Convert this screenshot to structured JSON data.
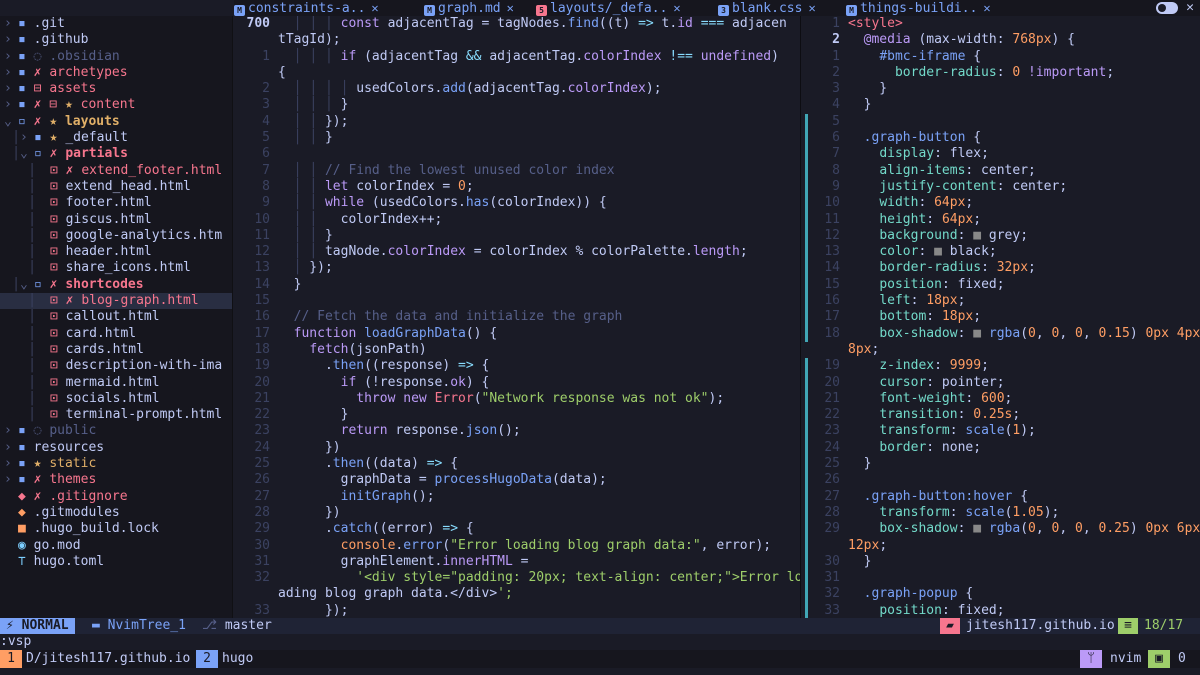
{
  "tabs": [
    {
      "label": "constraints-a..",
      "icon": "markdown-icon",
      "color": "#7aa2f7"
    },
    {
      "label": "graph.md",
      "icon": "markdown-icon",
      "color": "#7aa2f7"
    },
    {
      "label": "layouts/_defa..",
      "icon": "html-icon",
      "color": "#f7768e"
    },
    {
      "label": "blank.css",
      "icon": "css-icon",
      "color": "#7aa2f7"
    },
    {
      "label": "things-buildi..",
      "icon": "markdown-icon",
      "color": "#7aa2f7"
    }
  ],
  "tab_close": "✕",
  "tree": [
    {
      "arrow": "›",
      "icon": "▪",
      "mark": "",
      "name": ".git",
      "cls": "c-file",
      "indent": 0
    },
    {
      "arrow": "›",
      "icon": "▪",
      "mark": "",
      "name": ".github",
      "cls": "c-file",
      "indent": 0
    },
    {
      "arrow": "›",
      "icon": "▪",
      "mark": "◌",
      "name": ".obsidian",
      "cls": "c-dim",
      "indent": 0
    },
    {
      "arrow": "›",
      "icon": "▪",
      "mark": "✗",
      "name": "archetypes",
      "cls": "c-red",
      "indent": 0
    },
    {
      "arrow": "›",
      "icon": "▪",
      "mark": "⊟",
      "name": "assets",
      "cls": "c-red",
      "indent": 0
    },
    {
      "arrow": "›",
      "icon": "▪",
      "mark": "✗ ⊟ ★",
      "name": "content",
      "cls": "c-red",
      "indent": 0
    },
    {
      "arrow": "⌄",
      "icon": "▫",
      "mark": "✗ ★",
      "name": "layouts",
      "cls": "c-yel c-bold",
      "indent": 0
    },
    {
      "arrow": "›",
      "icon": "▪",
      "mark": "★",
      "name": "_default",
      "cls": "c-file",
      "indent": 1
    },
    {
      "arrow": "⌄",
      "icon": "▫",
      "mark": "✗",
      "name": "partials",
      "cls": "c-red c-bold",
      "indent": 1
    },
    {
      "arrow": "",
      "icon": "⊡",
      "mark": "✗",
      "name": "extend_footer.html",
      "cls": "c-red",
      "indent": 2
    },
    {
      "arrow": "",
      "icon": "⊡",
      "mark": "",
      "name": "extend_head.html",
      "cls": "c-file",
      "indent": 2
    },
    {
      "arrow": "",
      "icon": "⊡",
      "mark": "",
      "name": "footer.html",
      "cls": "c-file",
      "indent": 2
    },
    {
      "arrow": "",
      "icon": "⊡",
      "mark": "",
      "name": "giscus.html",
      "cls": "c-file",
      "indent": 2
    },
    {
      "arrow": "",
      "icon": "⊡",
      "mark": "",
      "name": "google-analytics.htm",
      "cls": "c-file",
      "indent": 2
    },
    {
      "arrow": "",
      "icon": "⊡",
      "mark": "",
      "name": "header.html",
      "cls": "c-file",
      "indent": 2
    },
    {
      "arrow": "",
      "icon": "⊡",
      "mark": "",
      "name": "share_icons.html",
      "cls": "c-file",
      "indent": 2
    },
    {
      "arrow": "⌄",
      "icon": "▫",
      "mark": "✗",
      "name": "shortcodes",
      "cls": "c-red c-bold",
      "indent": 1
    },
    {
      "arrow": "",
      "icon": "⊡",
      "mark": "✗",
      "name": "blog-graph.html",
      "cls": "c-red",
      "indent": 2,
      "selected": true
    },
    {
      "arrow": "",
      "icon": "⊡",
      "mark": "",
      "name": "callout.html",
      "cls": "c-file",
      "indent": 2
    },
    {
      "arrow": "",
      "icon": "⊡",
      "mark": "",
      "name": "card.html",
      "cls": "c-file",
      "indent": 2
    },
    {
      "arrow": "",
      "icon": "⊡",
      "mark": "",
      "name": "cards.html",
      "cls": "c-file",
      "indent": 2
    },
    {
      "arrow": "",
      "icon": "⊡",
      "mark": "",
      "name": "description-with-ima",
      "cls": "c-file",
      "indent": 2
    },
    {
      "arrow": "",
      "icon": "⊡",
      "mark": "",
      "name": "mermaid.html",
      "cls": "c-file",
      "indent": 2
    },
    {
      "arrow": "",
      "icon": "⊡",
      "mark": "",
      "name": "socials.html",
      "cls": "c-file",
      "indent": 2
    },
    {
      "arrow": "",
      "icon": "⊡",
      "mark": "",
      "name": "terminal-prompt.html",
      "cls": "c-file",
      "indent": 2
    },
    {
      "arrow": "›",
      "icon": "▪",
      "mark": "◌",
      "name": "public",
      "cls": "c-dim",
      "indent": 0
    },
    {
      "arrow": "›",
      "icon": "▪",
      "mark": "",
      "name": "resources",
      "cls": "c-file",
      "indent": 0
    },
    {
      "arrow": "›",
      "icon": "▪",
      "mark": "★",
      "name": "static",
      "cls": "c-yel",
      "indent": 0
    },
    {
      "arrow": "›",
      "icon": "▪",
      "mark": "✗",
      "name": "themes",
      "cls": "c-red",
      "indent": 0
    },
    {
      "arrow": "",
      "icon": "◆",
      "mark": "✗",
      "name": ".gitignore",
      "cls": "c-red",
      "indent": 0
    },
    {
      "arrow": "",
      "icon": "◆",
      "mark": "",
      "name": ".gitmodules",
      "cls": "c-file",
      "indent": 0
    },
    {
      "arrow": "",
      "icon": "■",
      "mark": "",
      "name": ".hugo_build.lock",
      "cls": "c-file",
      "indent": 0
    },
    {
      "arrow": "",
      "icon": "◉",
      "mark": "",
      "name": "go.mod",
      "cls": "c-file",
      "indent": 0
    },
    {
      "arrow": "",
      "icon": "⊤",
      "mark": "",
      "name": "hugo.toml",
      "cls": "c-file",
      "indent": 0
    }
  ],
  "left_code": {
    "numbers": [
      "700",
      "",
      "1",
      "",
      "2",
      "3",
      "4",
      "5",
      "6",
      "7",
      "8",
      "9",
      "10",
      "11",
      "12",
      "13",
      "14",
      "15",
      "16",
      "17",
      "18",
      "19",
      "20",
      "21",
      "22",
      "23",
      "24",
      "25",
      "26",
      "27",
      "28",
      "29",
      "30",
      "31",
      "32",
      "",
      "33"
    ],
    "current": 0,
    "lines": [
      "  │ │ │ const adjacentTag = tagNodes.find((t) => t.id === adjacen",
      "tTagId);",
      "  │ │ │ if (adjacentTag && adjacentTag.colorIndex !== undefined)",
      "{",
      "  │ │ │ │ usedColors.add(adjacentTag.colorIndex);",
      "  │ │ │ }",
      "  │ │ });",
      "  │ │ }",
      "",
      "  │ │ // Find the lowest unused color index",
      "  │ │ let colorIndex = 0;",
      "  │ │ while (usedColors.has(colorIndex)) {",
      "  │ │   colorIndex++;",
      "  │ │ }",
      "  │ │ tagNode.colorIndex = colorIndex % colorPalette.length;",
      "  │ });",
      "  }",
      "",
      "  // Fetch the data and initialize the graph",
      "  function loadGraphData() {",
      "    fetch(jsonPath)",
      "      .then((response) => {",
      "        if (!response.ok) {",
      "          throw new Error(\"Network response was not ok\");",
      "        }",
      "        return response.json();",
      "      })",
      "      .then((data) => {",
      "        graphData = processHugoData(data);",
      "        initGraph();",
      "      })",
      "      .catch((error) => {",
      "        console.error(\"Error loading blog graph data:\", error);",
      "        graphElement.innerHTML =",
      "          '<div style=\"padding: 20px; text-align: center;\">Error lo",
      "ading blog graph data.</div>';",
      "      });"
    ]
  },
  "right_code": {
    "numbers": [
      "1",
      "2",
      "1",
      "2",
      "3",
      "4",
      "5",
      "6",
      "7",
      "8",
      "9",
      "10",
      "11",
      "12",
      "13",
      "14",
      "15",
      "16",
      "17",
      "18",
      "",
      "19",
      "20",
      "21",
      "22",
      "23",
      "24",
      "25",
      "26",
      "27",
      "28",
      "29",
      "",
      "30",
      "31",
      "32",
      "33"
    ],
    "current": 1,
    "lines": [
      "<style>",
      "  @media (max-width: 768px) {",
      "    #bmc-iframe {",
      "      border-radius: 0 !important;",
      "    }",
      "  }",
      "",
      "  .graph-button {",
      "    display: flex;",
      "    align-items: center;",
      "    justify-content: center;",
      "    width: 64px;",
      "    height: 64px;",
      "    background: ■ grey;",
      "    color: ■ black;",
      "    border-radius: 32px;",
      "    position: fixed;",
      "    left: 18px;",
      "    bottom: 18px;",
      "    box-shadow: ■ rgba(0, 0, 0, 0.15) 0px 4px",
      "8px;",
      "    z-index: 9999;",
      "    cursor: pointer;",
      "    font-weight: 600;",
      "    transition: 0.25s;",
      "    transform: scale(1);",
      "    border: none;",
      "  }",
      "",
      "  .graph-button:hover {",
      "    transform: scale(1.05);",
      "    box-shadow: ■ rgba(0, 0, 0, 0.25) 0px 6px",
      "12px;",
      "  }",
      "",
      "  .graph-popup {",
      "    position: fixed;"
    ]
  },
  "status": {
    "mode": "NORMAL",
    "buffer": "NvimTree_1",
    "branch": "master",
    "repo": "jitesh117.github.io",
    "position": "18/17"
  },
  "cmdline": ":vsp",
  "tmux": {
    "win1_index": "1",
    "win1_name": "D/jitesh117.github.io",
    "win2_index": "2",
    "win2_name": "hugo",
    "app": "nvim",
    "count": "0"
  },
  "colors": {
    "accent": "#7aa2f7",
    "git_red": "#f7768e",
    "git_yellow": "#e0af68",
    "bg": "#1a1b26"
  }
}
